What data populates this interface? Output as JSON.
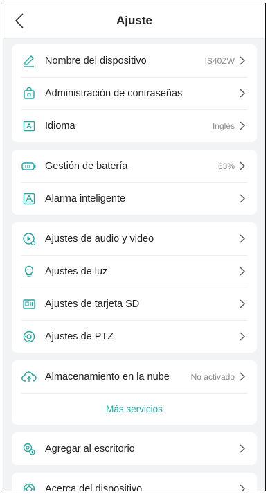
{
  "header": {
    "title": "Ajuste"
  },
  "groups": [
    {
      "items": [
        {
          "label": "Nombre del dispositivo",
          "value": "IS40ZW",
          "icon": "pencil-icon"
        },
        {
          "label": "Administración de contraseñas",
          "value": "",
          "icon": "lock-icon"
        },
        {
          "label": "Idioma",
          "value": "Inglés",
          "icon": "language-icon"
        }
      ]
    },
    {
      "items": [
        {
          "label": "Gestión de batería",
          "value": "63%",
          "icon": "battery-icon"
        },
        {
          "label": "Alarma inteligente",
          "value": "",
          "icon": "alarm-icon"
        }
      ]
    },
    {
      "items": [
        {
          "label": "Ajustes de audio y video",
          "value": "",
          "icon": "audio-video-icon"
        },
        {
          "label": "Ajustes de luz",
          "value": "",
          "icon": "lightbulb-icon"
        },
        {
          "label": "Ajustes de tarjeta SD",
          "value": "",
          "icon": "sd-card-icon"
        },
        {
          "label": "Ajustes de PTZ",
          "value": "",
          "icon": "ptz-icon"
        }
      ]
    },
    {
      "items": [
        {
          "label": "Almacenamiento en la nube",
          "value": "No activado",
          "icon": "cloud-upload-icon"
        }
      ],
      "footer_link": "Más servicios"
    },
    {
      "items": [
        {
          "label": "Agregar al escritorio",
          "value": "",
          "icon": "add-desktop-icon"
        }
      ]
    },
    {
      "items": [
        {
          "label": "Acerca del dispositivo",
          "value": "",
          "icon": "about-device-icon"
        }
      ]
    }
  ],
  "colors": {
    "accent": "#20a7a0",
    "icon": "#20a7a0",
    "background": "#f2f3f5"
  }
}
